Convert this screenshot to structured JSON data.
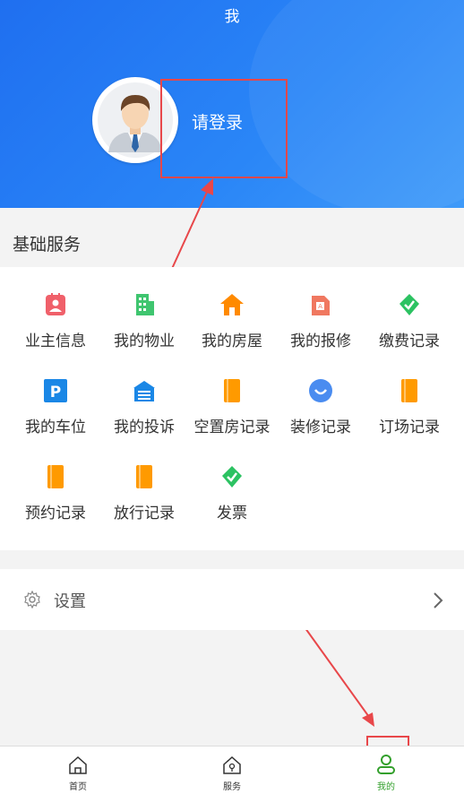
{
  "header": {
    "title": "我",
    "login_text": "请登录"
  },
  "section": {
    "title": "基础服务"
  },
  "services": [
    {
      "label": "业主信息",
      "icon": "id-card-icon",
      "color": "#f0606a"
    },
    {
      "label": "我的物业",
      "icon": "building-icon",
      "color": "#3fc56f"
    },
    {
      "label": "我的房屋",
      "icon": "house-icon",
      "color": "#ff8a00"
    },
    {
      "label": "我的报修",
      "icon": "repair-icon",
      "color": "#f07860"
    },
    {
      "label": "缴费记录",
      "icon": "payment-leaf-icon",
      "color": "#2cc262"
    },
    {
      "label": "我的车位",
      "icon": "parking-icon",
      "color": "#1a87e6"
    },
    {
      "label": "我的投诉",
      "icon": "complaint-icon",
      "color": "#1a87e6"
    },
    {
      "label": "空置房记录",
      "icon": "book-icon",
      "color": "#ff9a00"
    },
    {
      "label": "装修记录",
      "icon": "smile-icon",
      "color": "#4a8cf0"
    },
    {
      "label": "订场记录",
      "icon": "book-icon",
      "color": "#ff9a00"
    },
    {
      "label": "预约记录",
      "icon": "book-icon",
      "color": "#ff9a00"
    },
    {
      "label": "放行记录",
      "icon": "book-icon",
      "color": "#ff9a00"
    },
    {
      "label": "发票",
      "icon": "invoice-leaf-icon",
      "color": "#2cc262"
    }
  ],
  "settings": {
    "label": "设置"
  },
  "tabbar": {
    "tabs": [
      {
        "label": "首页"
      },
      {
        "label": "服务"
      },
      {
        "label": "我的"
      }
    ]
  },
  "colors": {
    "accent": "#2a7df2",
    "annotation": "#e8474a",
    "active_tab": "#33a02c"
  }
}
